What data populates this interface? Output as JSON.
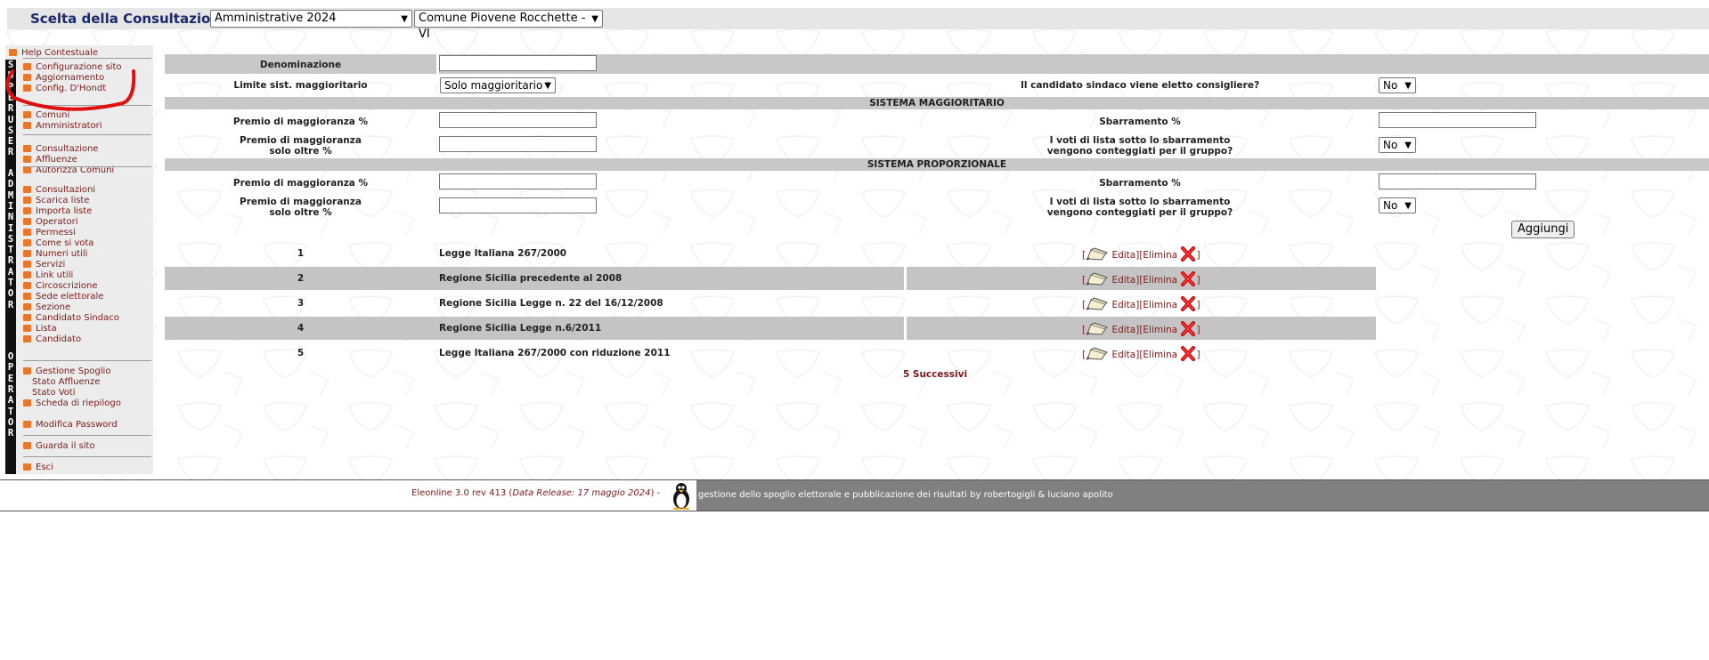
{
  "topbar": {
    "label": "Scelta della Consultazione:",
    "consultation_selected": "Amministrative 2024",
    "comune_selected": "Comune Piovene Rocchette - VI"
  },
  "sidebar": {
    "vertical_labels": [
      "S",
      "U",
      "P",
      "E",
      "R",
      "U",
      "S",
      "E",
      "R",
      "A",
      "D",
      "M",
      "I",
      "N",
      "I",
      "S",
      "T",
      "R",
      "A",
      "T",
      "O",
      "R",
      "O",
      "P",
      "E",
      "R",
      "A",
      "T",
      "O",
      "R"
    ],
    "help": "Help Contestuale",
    "group1": [
      "Configurazione sito",
      "Aggiornamento",
      "Config. D'Hondt"
    ],
    "group2": [
      "Comuni",
      "Amministratori"
    ],
    "group3": [
      "Consultazione",
      "Affluenze",
      "Autorizza Comuni"
    ],
    "group4": [
      "Consultazioni",
      "Scarica liste",
      "Importa liste",
      "Operatori",
      "Permessi",
      "Come si vota",
      "Numeri utili",
      "Servizi",
      "Link utili",
      "Circoscrizione",
      "Sede elettorale",
      "Sezione",
      "Candidato Sindaco",
      "Lista",
      "Candidato"
    ],
    "group5": [
      "Gestione Spoglio",
      "Stato Affluenze",
      "Stato Voti",
      "Scheda di riepilogo"
    ],
    "modifica_password": "Modifica Password",
    "guarda_sito": "Guarda il sito",
    "esci": "Esci"
  },
  "form": {
    "denominazione_label": "Denominazione",
    "limite_label": "Limite sist. maggioritario",
    "limite_value": "Solo maggioritario",
    "sindaco_label": "Il candidato sindaco viene eletto consigliere?",
    "sindaco_value": "No",
    "sect_magg": "SISTEMA MAGGIORITARIO",
    "sect_prop": "SISTEMA PROPORZIONALE",
    "premio_label": "Premio di maggioranza %",
    "premio_oltre_label_1": "Premio di maggioranza",
    "premio_oltre_label_2": "solo oltre %",
    "sbarramento_label": "Sbarramento %",
    "voti_label_1": "I voti di lista sotto lo sbarramento",
    "voti_label_2": "vengono conteggiati per il gruppo?",
    "voti_magg_value": "No",
    "voti_prop_value": "No",
    "aggiungi": "Aggiungi"
  },
  "table": {
    "rows": [
      {
        "num": "1",
        "name": "Legge Italiana 267/2000"
      },
      {
        "num": "2",
        "name": "Regione Sicilia precedente al 2008"
      },
      {
        "num": "3",
        "name": "Regione Sicilia Legge n. 22 del 16/12/2008"
      },
      {
        "num": "4",
        "name": "Regione Sicilia Legge n.6/2011"
      },
      {
        "num": "5",
        "name": "Legge Italiana 267/2000 con riduzione 2011"
      }
    ],
    "edit_label": "Edita][Elimina",
    "bracket_open": "[",
    "bracket_close": "]",
    "pagination": "5 Successivi"
  },
  "footer": {
    "version": "Eleonline 3.0 rev 413 (",
    "release": "Data Release: 17 maggio 2024",
    "version_end": ") -",
    "credits": "gestione dello spoglio elettorale e pubblicazione dei risultati by robertogigli & luciano apolito"
  },
  "colors": {
    "accent_bullet": "#e8772a",
    "link": "#7a1a1a",
    "title": "#1a2a6c",
    "band": "#c8c8c8",
    "delete": "#cc0000"
  }
}
